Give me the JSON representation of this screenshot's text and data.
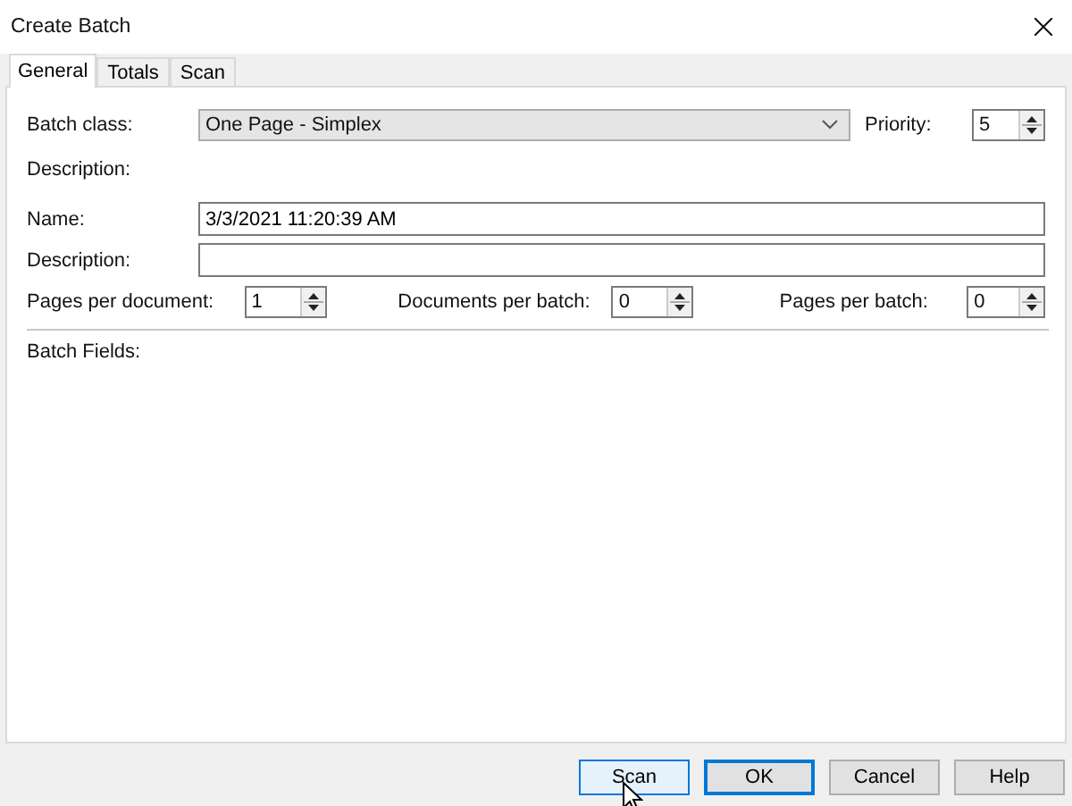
{
  "window": {
    "title": "Create Batch"
  },
  "tabs": [
    {
      "label": "General",
      "selected": true
    },
    {
      "label": "Totals",
      "selected": false
    },
    {
      "label": "Scan",
      "selected": false
    }
  ],
  "batch_class": {
    "label": "Batch class:",
    "value": "One Page - Simplex"
  },
  "priority": {
    "label": "Priority:",
    "value": "5"
  },
  "batch_class_description": {
    "label": "Description:"
  },
  "name": {
    "label": "Name:",
    "value": "3/3/2021 11:20:39 AM"
  },
  "description": {
    "label": "Description:"
  },
  "counts": [
    {
      "label": "Pages per document:",
      "value": "1"
    },
    {
      "label": "Documents per batch:",
      "value": "0"
    },
    {
      "label": "Pages per batch:",
      "value": "0"
    }
  ],
  "batch_fields": {
    "label": "Batch Fields:"
  },
  "buttons": [
    {
      "label": "Scan",
      "hovered": true,
      "default": false
    },
    {
      "label": "OK",
      "hovered": false,
      "default": true
    },
    {
      "label": "Cancel",
      "hovered": false,
      "default": false
    },
    {
      "label": "Help",
      "hovered": false,
      "default": false
    }
  ]
}
